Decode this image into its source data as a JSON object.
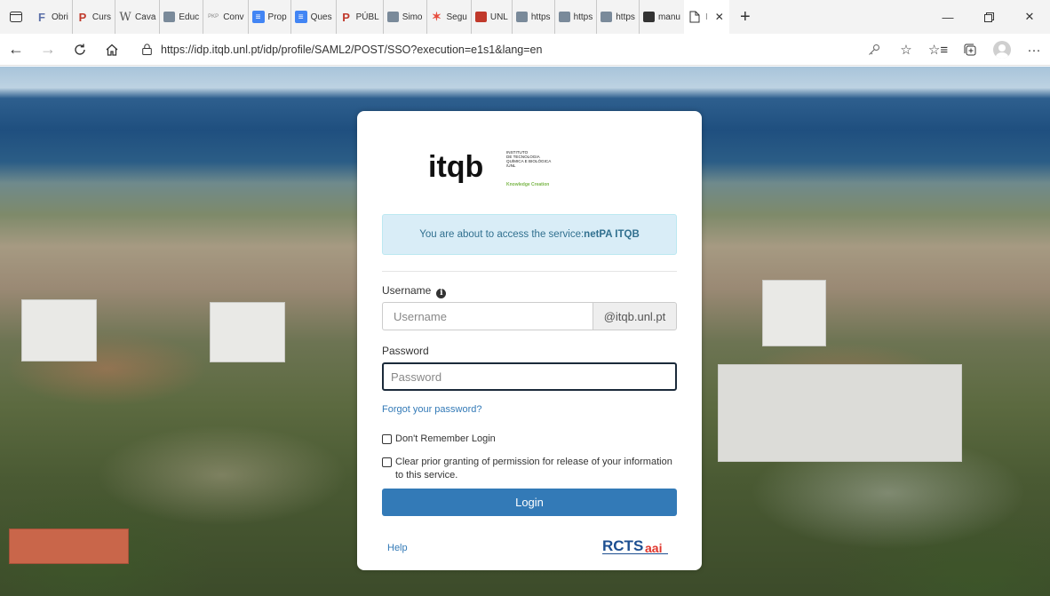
{
  "browser": {
    "tabs": [
      {
        "label": "Obri",
        "icon": "f-icon",
        "color": "#5b6fa8"
      },
      {
        "label": "Curs",
        "icon": "p-icon",
        "color": "#c0392b"
      },
      {
        "label": "Cava",
        "icon": "w-icon",
        "color": "#555555"
      },
      {
        "label": "Educ",
        "icon": "grid-icon",
        "color": "#7a8a9a"
      },
      {
        "label": "Conv",
        "icon": "pkp-icon",
        "color": "#888888"
      },
      {
        "label": "Prop",
        "icon": "doc-icon",
        "color": "#4285f4"
      },
      {
        "label": "Ques",
        "icon": "doc-icon",
        "color": "#4285f4"
      },
      {
        "label": "PÚBL",
        "icon": "p-icon",
        "color": "#c0392b"
      },
      {
        "label": "Simo",
        "icon": "grid-icon",
        "color": "#7a8a9a"
      },
      {
        "label": "Segu",
        "icon": "star-icon",
        "color": "#e74c3c"
      },
      {
        "label": "UNL",
        "icon": "unl-icon",
        "color": "#c0392b"
      },
      {
        "label": "https",
        "icon": "grid-icon",
        "color": "#7a8a9a"
      },
      {
        "label": "https",
        "icon": "grid-icon",
        "color": "#7a8a9a"
      },
      {
        "label": "https",
        "icon": "grid-icon",
        "color": "#7a8a9a"
      },
      {
        "label": "manu",
        "icon": "grid-icon",
        "color": "#333333"
      }
    ],
    "active_tab_label": "I",
    "url": "https://idp.itqb.unl.pt/idp/profile/SAML2/POST/SSO?execution=e1s1&lang=en"
  },
  "login": {
    "logo": {
      "brand": "itqb",
      "line1": "INSTITUTO",
      "line2": "DE TECNOLOGIA",
      "line3": "QUÍMICA E BIOLÓGICA",
      "line4": "/UNL",
      "tagline": "Knowledge Creation"
    },
    "notice_prefix": "You are about to access the service:",
    "service_name": "netPA ITQB",
    "username_label": "Username",
    "username_placeholder": "Username",
    "username_suffix": "@itqb.unl.pt",
    "password_label": "Password",
    "password_placeholder": "Password",
    "forgot_link": "Forgot your password?",
    "dont_remember": "Don't Remember Login",
    "clear_consent": "Clear prior granting of permission for release of your information to this service.",
    "login_button": "Login",
    "help_link": "Help",
    "footer_logo_main": "RCTS",
    "footer_logo_suffix": "aai"
  },
  "colors": {
    "primary": "#337ab7",
    "notice_bg": "#d9edf7",
    "notice_text": "#31708f",
    "logo_green": "#7ab648"
  }
}
